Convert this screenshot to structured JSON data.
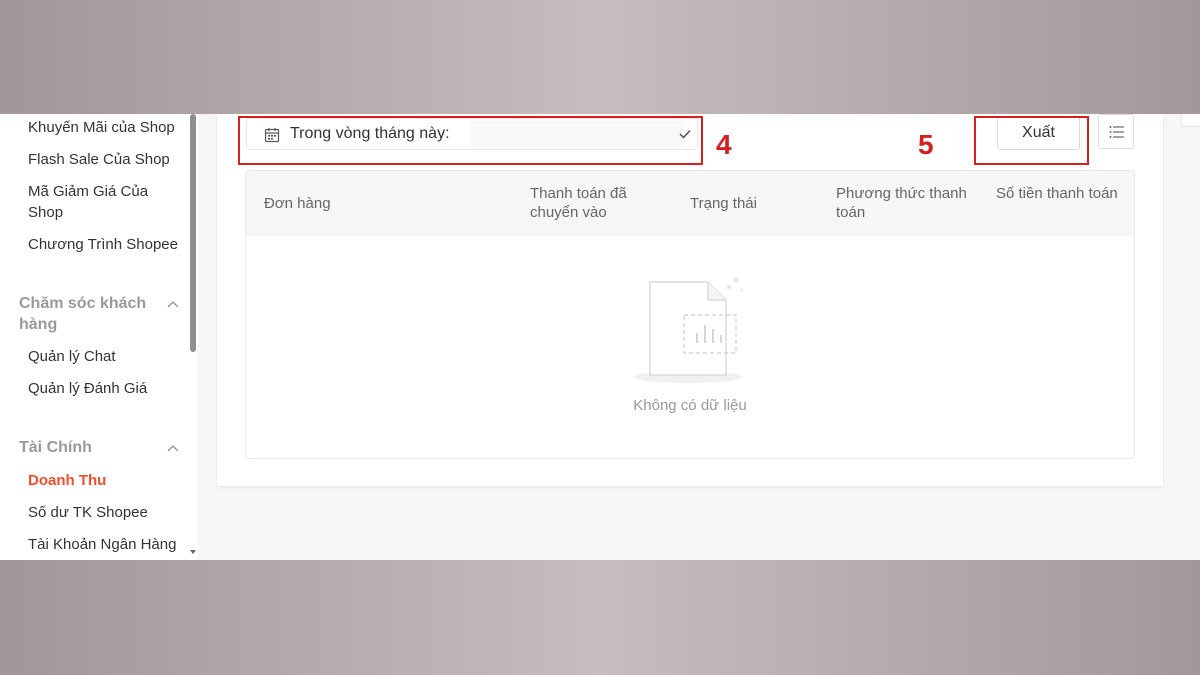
{
  "sidebar": {
    "items_marketing": [
      "Khuyến Mãi của Shop",
      "Flash Sale Của Shop",
      "Mã Giảm Giá Của Shop",
      "Chương Trình Shopee"
    ],
    "section_customer": "Chăm sóc khách hàng",
    "items_customer": [
      "Quản lý Chat",
      "Quản lý Đánh Giá"
    ],
    "section_finance": "Tài Chính",
    "items_finance": [
      "Doanh Thu",
      "Số dư TK Shopee",
      "Tài Khoản Ngân Hàng"
    ]
  },
  "filter": {
    "label": "Trong vòng tháng này:",
    "value": ""
  },
  "annotations": {
    "filter_number": "4",
    "export_number": "5"
  },
  "toolbar": {
    "export_label": "Xuất"
  },
  "table": {
    "columns": [
      "Đơn hàng",
      "Thanh toán đã chuyển vào",
      "Trạng thái",
      "Phương thức thanh toán",
      "Số tiền thanh toán"
    ],
    "empty_text": "Không có dữ liệu"
  },
  "colors": {
    "accent": "#ee4d2d",
    "annotation": "#d42020"
  },
  "icons": {
    "calendar": "calendar-icon",
    "check": "check-icon",
    "list": "list-icon",
    "empty": "empty-document-chart-icon"
  }
}
